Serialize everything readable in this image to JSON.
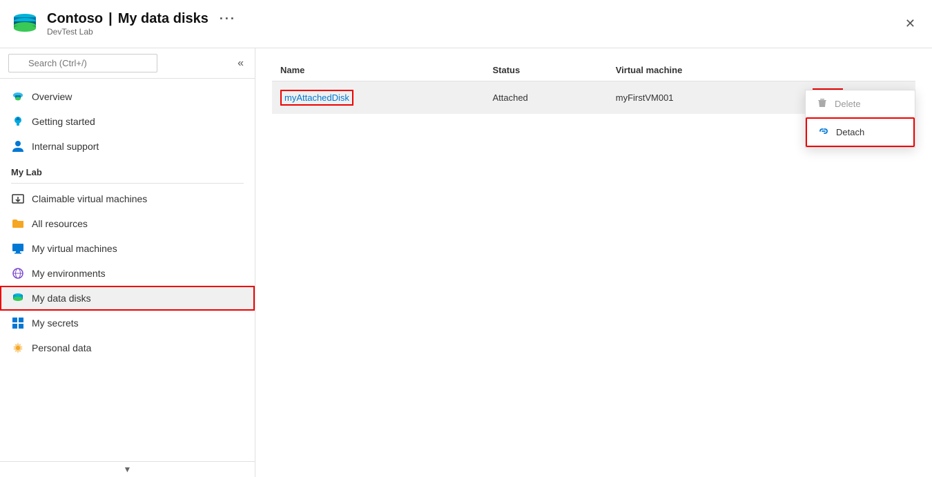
{
  "header": {
    "title": "Contoso | My data disks",
    "resource_name": "Contoso",
    "page_name": "My data disks",
    "subtitle": "DevTest Lab",
    "ellipsis_label": "···",
    "close_label": "✕"
  },
  "sidebar": {
    "search_placeholder": "Search (Ctrl+/)",
    "collapse_icon": "«",
    "nav_items": [
      {
        "id": "overview",
        "label": "Overview",
        "icon": "cloud-upload"
      },
      {
        "id": "getting-started",
        "label": "Getting started",
        "icon": "rocket"
      },
      {
        "id": "internal-support",
        "label": "Internal support",
        "icon": "person"
      }
    ],
    "my_lab_label": "My Lab",
    "my_lab_items": [
      {
        "id": "claimable-vms",
        "label": "Claimable virtual machines",
        "icon": "download-box"
      },
      {
        "id": "all-resources",
        "label": "All resources",
        "icon": "folder-yellow"
      },
      {
        "id": "my-vms",
        "label": "My virtual machines",
        "icon": "monitor"
      },
      {
        "id": "my-environments",
        "label": "My environments",
        "icon": "globe-purple"
      },
      {
        "id": "my-data-disks",
        "label": "My data disks",
        "icon": "disks",
        "active": true
      },
      {
        "id": "my-secrets",
        "label": "My secrets",
        "icon": "grid-blue"
      },
      {
        "id": "personal-data",
        "label": "Personal data",
        "icon": "gear-yellow"
      }
    ]
  },
  "table": {
    "columns": [
      "Name",
      "Status",
      "Virtual machine"
    ],
    "rows": [
      {
        "name": "myAttachedDisk",
        "status": "Attached",
        "virtual_machine": "myFirstVM001",
        "more_button_label": "···"
      }
    ]
  },
  "context_menu": {
    "items": [
      {
        "id": "delete",
        "label": "Delete",
        "icon": "trash",
        "disabled": true
      },
      {
        "id": "detach",
        "label": "Detach",
        "icon": "link-break",
        "highlighted": true
      }
    ]
  }
}
